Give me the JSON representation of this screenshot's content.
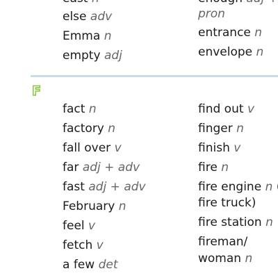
{
  "top_left": [
    {
      "word": "east",
      "pos": "n"
    },
    {
      "word": "else",
      "pos": "adv"
    },
    {
      "word": "Emma",
      "pos": "n"
    },
    {
      "word": "empty",
      "pos": "adj"
    }
  ],
  "top_right": [
    {
      "word": "enough",
      "pos": "adj +"
    },
    {
      "word": "",
      "pos": "pron"
    },
    {
      "word": "entrance",
      "pos": "n"
    },
    {
      "word": "envelope",
      "pos": "n"
    }
  ],
  "section": {
    "letter": "F"
  },
  "left_column": [
    {
      "word": "fact",
      "pos": "n"
    },
    {
      "word": "factory",
      "pos": "n"
    },
    {
      "word": "fall over",
      "pos": "v"
    },
    {
      "word": "far",
      "pos": "adj + adv"
    },
    {
      "word": "fast",
      "pos": "adj + adv"
    },
    {
      "word": "February",
      "pos": "n"
    },
    {
      "word": "feel",
      "pos": "v"
    },
    {
      "word": "fetch",
      "pos": "v"
    },
    {
      "word": "a few",
      "pos": "det"
    }
  ],
  "right_column": [
    {
      "word": "find out",
      "pos": "v"
    },
    {
      "word": "finger",
      "pos": "n"
    },
    {
      "word": "finish",
      "pos": "v"
    },
    {
      "word": "fire",
      "pos": "n"
    },
    {
      "word": "fire engine",
      "pos": "n",
      "extra": "(U"
    },
    {
      "word": "fire truck)",
      "pos": ""
    },
    {
      "word": "fire station",
      "pos": "n"
    },
    {
      "word": "fireman/",
      "pos": ""
    },
    {
      "word": "woman",
      "pos": "n"
    }
  ]
}
